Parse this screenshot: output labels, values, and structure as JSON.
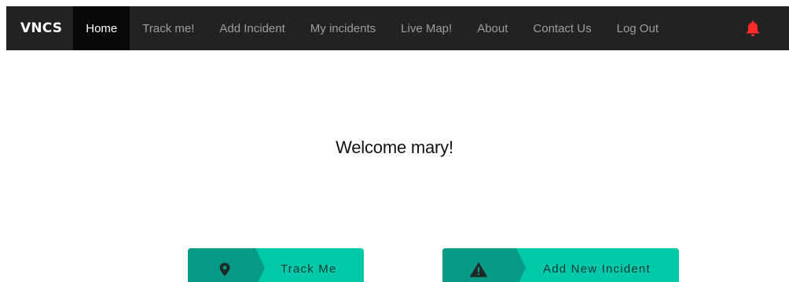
{
  "nav": {
    "brand": "VNCS",
    "items": [
      {
        "label": "Home",
        "active": true
      },
      {
        "label": "Track me!"
      },
      {
        "label": "Add Incident"
      },
      {
        "label": "My incidents"
      },
      {
        "label": "Live Map!"
      },
      {
        "label": "About"
      },
      {
        "label": "Contact Us"
      },
      {
        "label": "Log Out"
      }
    ],
    "notification_icon": "bell-icon",
    "notification_color": "#ff2a2a"
  },
  "main": {
    "welcome_text": "Welcome mary!"
  },
  "actions": {
    "track_me": {
      "label": "Track Me",
      "icon": "map-marker-icon"
    },
    "add_incident": {
      "label": "Add New Incident",
      "icon": "warning-icon"
    }
  },
  "colors": {
    "navbar_bg": "#222222",
    "nav_active_bg": "#080808",
    "nav_text": "#9d9d9d",
    "button_bg": "#00c9aa",
    "button_icon_bg": "#079a86",
    "button_text": "#0d3b36"
  }
}
